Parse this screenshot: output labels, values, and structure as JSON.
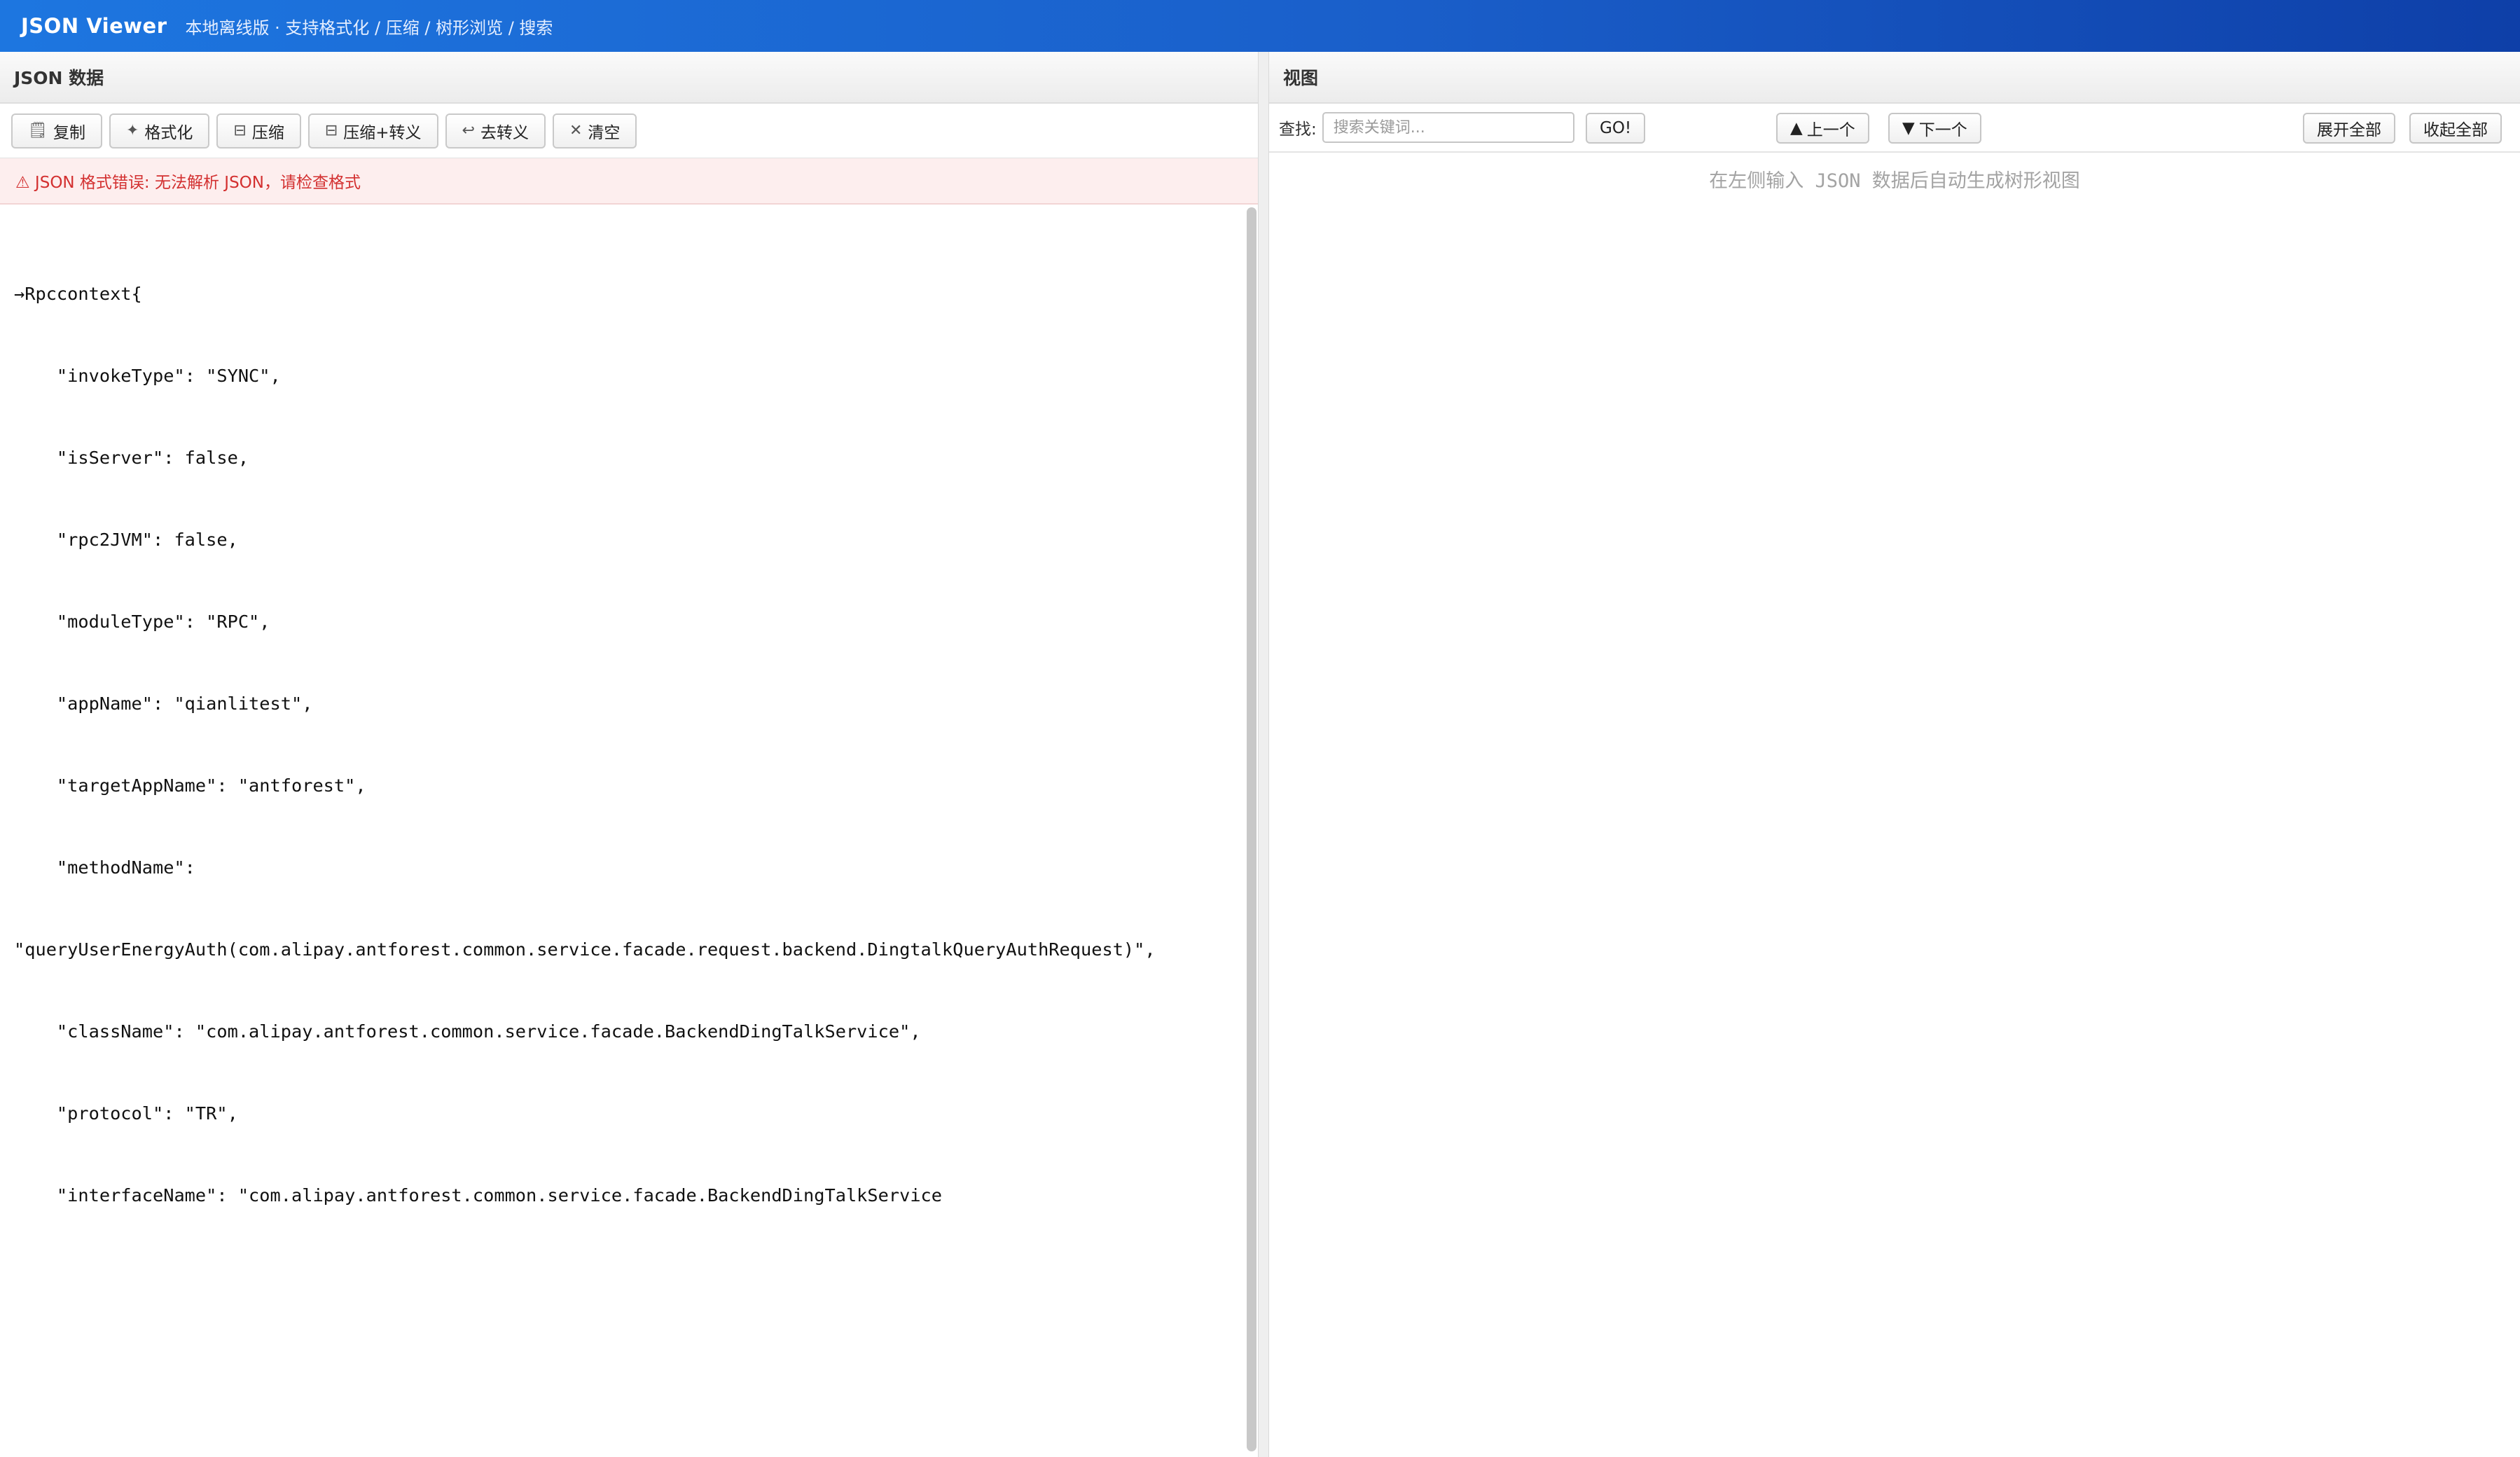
{
  "header": {
    "title": "JSON Viewer",
    "subtitle": "本地离线版 · 支持格式化 / 压缩 / 树形浏览 / 搜索"
  },
  "left_panel": {
    "title": "JSON 数据",
    "toolbar": {
      "copy_label": "复制",
      "format_label": "格式化",
      "compress_label": "压缩",
      "compress_escape_label": "压缩+转义",
      "unescape_label": "去转义",
      "clear_label": "清空"
    },
    "error_message": "⚠ JSON 格式错误: 无法解析 JSON，请检查格式",
    "code_lines": [
      "→Rpccontext{",
      "    \"invokeType\": \"SYNC\",",
      "    \"isServer\": false,",
      "    \"rpc2JVM\": false,",
      "    \"moduleType\": \"RPC\",",
      "    \"appName\": \"qianlitest\",",
      "    \"targetAppName\": \"antforest\",",
      "    \"methodName\":",
      "\"queryUserEnergyAuth(com.alipay.antforest.common.service.facade.request.backend.DingtalkQueryAuthRequest)\",",
      "    \"className\": \"com.alipay.antforest.common.service.facade.BackendDingTalkService\",",
      "    \"protocol\": \"TR\",",
      "    \"interfaceName\": \"com.alipay.antforest.common.service.facade.BackendDingTalkService"
    ]
  },
  "right_panel": {
    "title": "视图",
    "search": {
      "label": "查找:",
      "placeholder": "搜索关键词...",
      "value": "",
      "go_label": "GO!",
      "prev_label": "上一个",
      "next_label": "下一个"
    },
    "expand_all_label": "展开全部",
    "collapse_all_label": "收起全部",
    "empty_hint": "在左侧输入 JSON 数据后自动生成树形视图"
  },
  "icons": {
    "copy": "clipboard-icon",
    "format": "sparkle-icon",
    "compress": "compress-icon",
    "compress_escape": "compress-icon",
    "unescape": "return-arrow-icon",
    "clear": "close-icon",
    "prev": "triangle-up-icon",
    "next": "triangle-down-icon"
  },
  "colors": {
    "header_gradient_start": "#1d76e0",
    "header_gradient_end": "#0e3fa8",
    "error_text": "#d33030",
    "error_background": "#fdeeee"
  }
}
